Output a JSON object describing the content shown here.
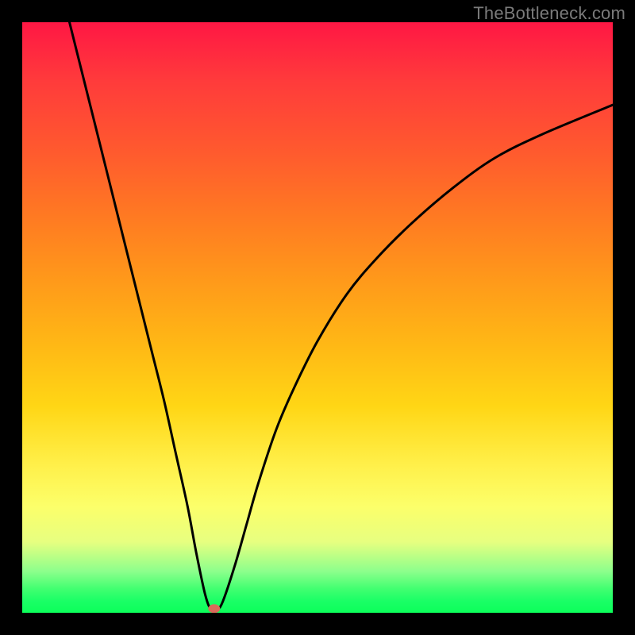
{
  "watermark": "TheBottleneck.com",
  "chart_data": {
    "type": "line",
    "title": "",
    "xlabel": "",
    "ylabel": "",
    "xlim": [
      0,
      100
    ],
    "ylim": [
      0,
      100
    ],
    "grid": false,
    "series": [
      {
        "name": "curve",
        "x": [
          8,
          10,
          12,
          14,
          16,
          18,
          20,
          22,
          24,
          26,
          28,
          29.5,
          31,
          32,
          33,
          34,
          36,
          38,
          40,
          43,
          46,
          50,
          55,
          60,
          66,
          73,
          80,
          88,
          100
        ],
        "y": [
          100,
          92,
          84,
          76,
          68,
          60,
          52,
          44,
          36,
          27,
          18,
          10,
          3,
          0.5,
          0.5,
          2,
          8,
          15,
          22,
          31,
          38,
          46,
          54,
          60,
          66,
          72,
          77,
          81,
          86
        ]
      }
    ],
    "marker": {
      "x": 32.5,
      "y": 0.7,
      "color": "#d96a5a"
    }
  }
}
